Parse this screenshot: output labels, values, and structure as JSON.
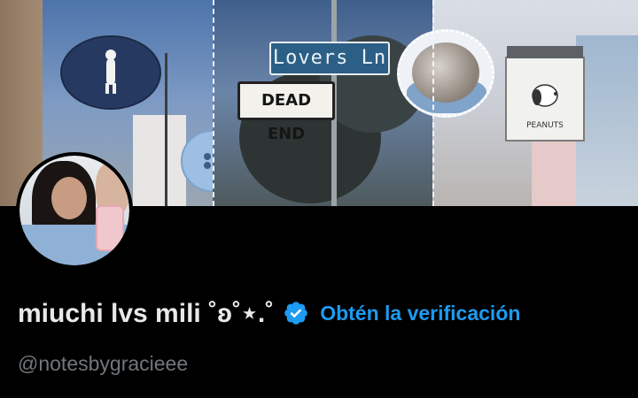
{
  "profile": {
    "display_name": "miuchi lvs mili ˚ʚ˚⋆.˚",
    "verify_cta": "Obtén la verificación",
    "handle": "@notesbygracieee"
  },
  "banner": {
    "street_sign_text": "Lovers Ln",
    "dead_end_text": "DEAD END",
    "peanuts_sign_text": "PEANUTS"
  },
  "colors": {
    "background": "#000000",
    "name_text": "#e7e9ea",
    "handle_text": "#71767b",
    "accent": "#1d9bf0"
  },
  "icons": {
    "verified": "verified-badge-icon"
  }
}
